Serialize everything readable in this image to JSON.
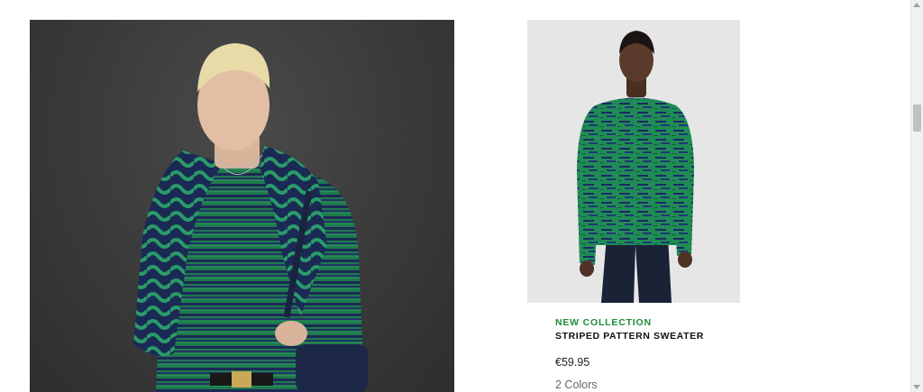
{
  "product": {
    "badge": "NEW COLLECTION",
    "name": "STRIPED PATTERN SWEATER",
    "price": "€59.95",
    "colors": "2 Colors"
  },
  "images": {
    "editorial": "model-wearing-striped-sweater-with-knit-scarf-and-bag",
    "product": "model-wearing-green-striped-sweater"
  },
  "theme": {
    "accent_green": "#1b8c3a",
    "sweater_green": "#1e7a4d",
    "sweater_navy": "#1c2a55",
    "hero_bg": "#3a3a3a",
    "card_bg": "#e6e6e6"
  }
}
